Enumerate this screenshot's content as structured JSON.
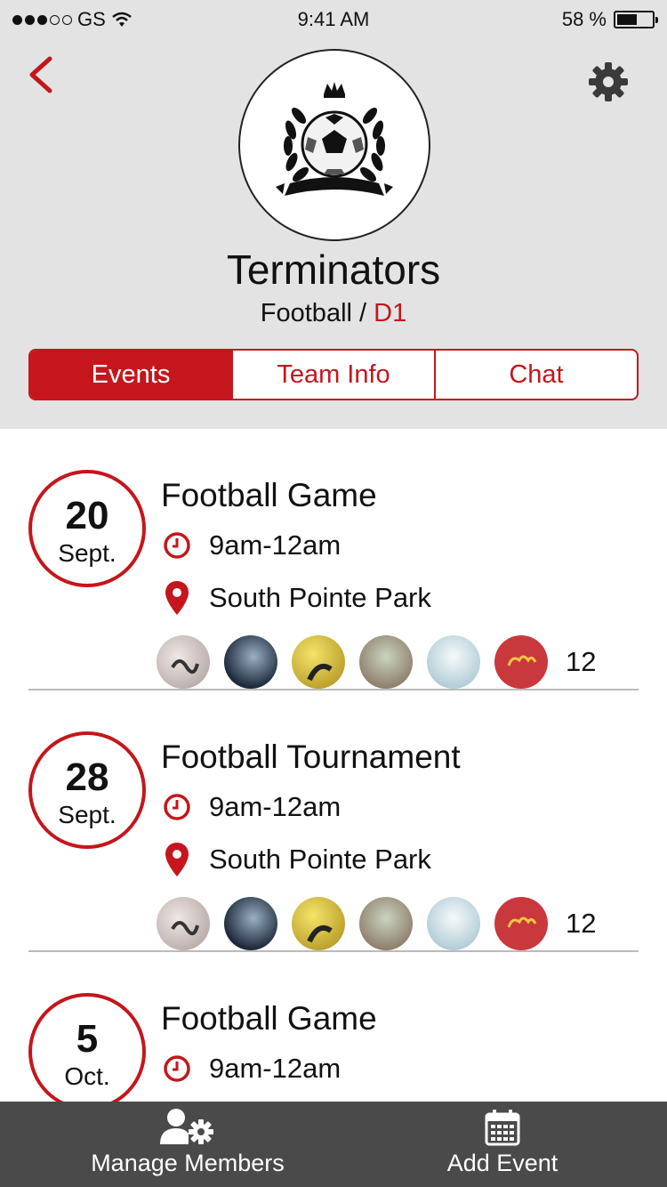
{
  "status_bar": {
    "carrier": "GS",
    "time": "9:41 AM",
    "battery": "58 %",
    "battery_level": 0.58,
    "signal_bars": 3
  },
  "header": {
    "team_name": "Terminators",
    "sport": "Football",
    "separator": " / ",
    "division": "D1"
  },
  "tabs": [
    {
      "label": "Events",
      "active": true
    },
    {
      "label": "Team Info",
      "active": false
    },
    {
      "label": "Chat",
      "active": false
    }
  ],
  "events": [
    {
      "day": "20",
      "month": "Sept.",
      "title": "Football Game",
      "time": "9am-12am",
      "location": "South Pointe Park",
      "attendee_count": "12"
    },
    {
      "day": "28",
      "month": "Sept.",
      "title": "Football Tournament",
      "time": "9am-12am",
      "location": "South Pointe Park",
      "attendee_count": "12"
    },
    {
      "day": "5",
      "month": "Oct.",
      "title": "Football Game",
      "time": "9am-12am"
    }
  ],
  "bottom_bar": {
    "manage_members": "Manage Members",
    "add_event": "Add Event"
  },
  "colors": {
    "accent": "#c4161c",
    "header_bg": "#e3e3e3",
    "bottom_bar_bg": "#4a4a4a"
  },
  "icons": [
    "back-chevron-icon",
    "gear-icon",
    "clock-icon",
    "location-pin-icon",
    "manage-members-icon",
    "calendar-icon"
  ]
}
